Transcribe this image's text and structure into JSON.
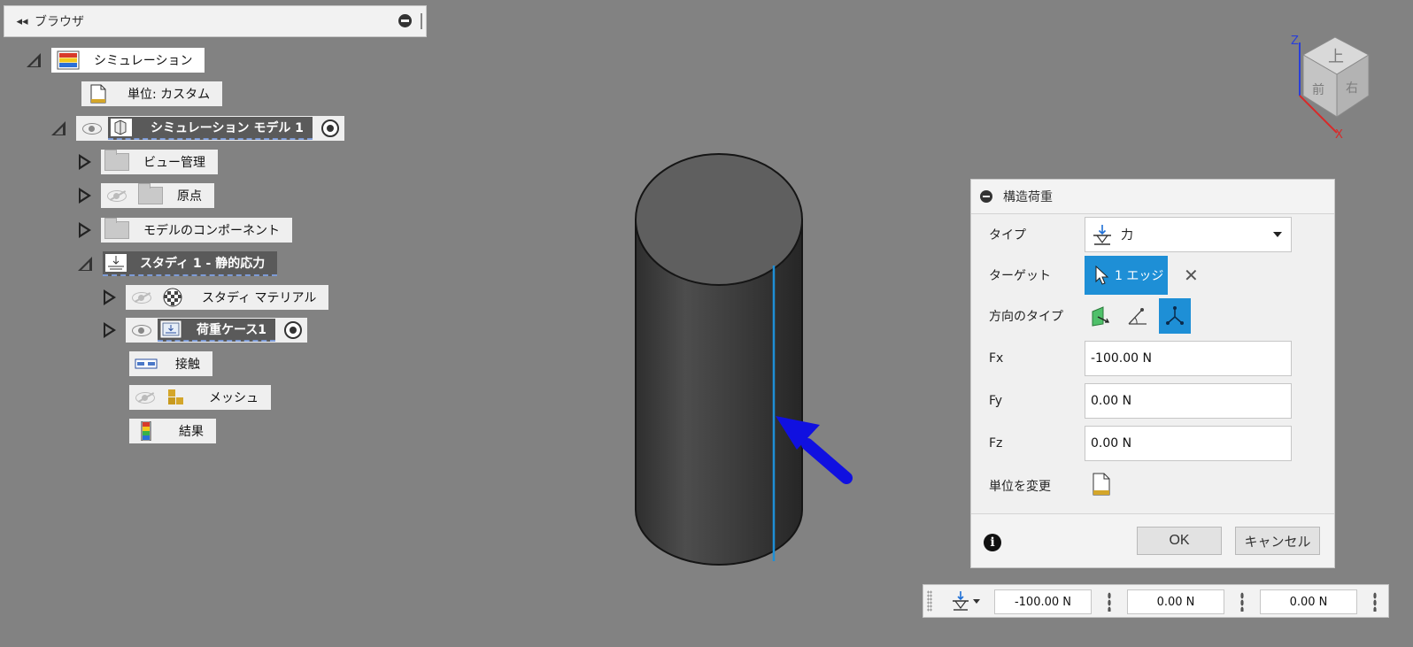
{
  "browser": {
    "title": "ブラウザ",
    "collapse_glyph": "◂◂",
    "nodes": {
      "simulation": "シミュレーション",
      "units": "単位: カスタム",
      "sim_model": "シミュレーション モデル 1",
      "view_manage": "ビュー管理",
      "origin": "原点",
      "model_components": "モデルのコンポーネント",
      "study": "スタディ 1 - 静的応力",
      "study_materials": "スタディ マテリアル",
      "load_case": "荷重ケース1",
      "contact": "接触",
      "mesh": "メッシュ",
      "results": "結果"
    }
  },
  "viewcube": {
    "faces": {
      "top": "上",
      "front": "前",
      "right": "右"
    },
    "axes": {
      "z": "Z",
      "x": "X"
    }
  },
  "dialog": {
    "title": "構造荷重",
    "type_label": "タイプ",
    "type_value": "力",
    "target_label": "ターゲット",
    "target_value": "1 エッジ",
    "clear_glyph": "✕",
    "direction_label": "方向のタイプ",
    "fx_label": "Fx",
    "fx_value": "-100.00 N",
    "fy_label": "Fy",
    "fy_value": "0.00 N",
    "fz_label": "Fz",
    "fz_value": "0.00 N",
    "units_label": "単位を変更",
    "ok": "OK",
    "cancel": "キャンセル"
  },
  "mini_toolbar": {
    "fx": "-100.00 N",
    "fy": "0.00 N",
    "fz": "0.00 N"
  },
  "colors": {
    "accent": "#1e8fd6",
    "viewport_bg": "#828282",
    "force_arrow": "#1010e0"
  }
}
